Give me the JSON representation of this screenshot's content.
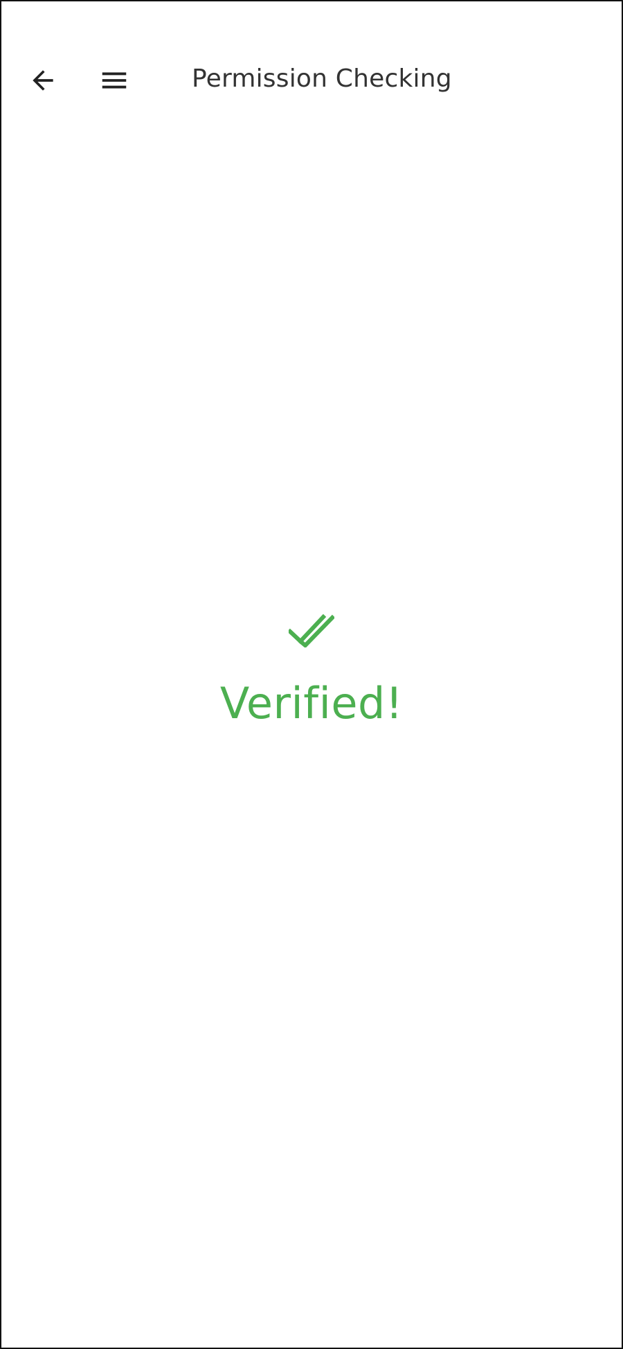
{
  "header": {
    "title": "Permission Checking",
    "back_icon": "arrow-left-icon",
    "menu_icon": "hamburger-menu-icon"
  },
  "status": {
    "icon": "double-check-icon",
    "text": "Verified!",
    "color": "#4caf50"
  },
  "colors": {
    "background": "#ffffff",
    "text": "#333333",
    "success": "#4caf50"
  }
}
